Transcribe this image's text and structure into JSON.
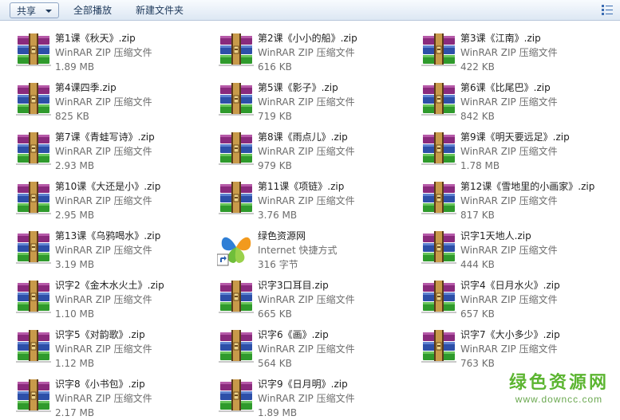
{
  "toolbar": {
    "share_label": "共享",
    "play_all_label": "全部播放",
    "new_folder_label": "新建文件夹",
    "view_icon": "view-options-icon"
  },
  "files": [
    {
      "name": "第1课《秋天》.zip",
      "type": "WinRAR ZIP 压缩文件",
      "size": "1.89 MB",
      "icon": "winrar-archive-icon"
    },
    {
      "name": "第2课《小小的船》.zip",
      "type": "WinRAR ZIP 压缩文件",
      "size": "616 KB",
      "icon": "winrar-archive-icon"
    },
    {
      "name": "第3课《江南》.zip",
      "type": "WinRAR ZIP 压缩文件",
      "size": "422 KB",
      "icon": "winrar-archive-icon"
    },
    {
      "name": "第4课四季.zip",
      "type": "WinRAR ZIP 压缩文件",
      "size": "825 KB",
      "icon": "winrar-archive-icon"
    },
    {
      "name": "第5课《影子》.zip",
      "type": "WinRAR ZIP 压缩文件",
      "size": "719 KB",
      "icon": "winrar-archive-icon"
    },
    {
      "name": "第6课《比尾巴》.zip",
      "type": "WinRAR ZIP 压缩文件",
      "size": "842 KB",
      "icon": "winrar-archive-icon"
    },
    {
      "name": "第7课《青蛙写诗》.zip",
      "type": "WinRAR ZIP 压缩文件",
      "size": "2.93 MB",
      "icon": "winrar-archive-icon"
    },
    {
      "name": "第8课《雨点儿》.zip",
      "type": "WinRAR ZIP 压缩文件",
      "size": "979 KB",
      "icon": "winrar-archive-icon"
    },
    {
      "name": "第9课《明天要远足》.zip",
      "type": "WinRAR ZIP 压缩文件",
      "size": "1.78 MB",
      "icon": "winrar-archive-icon"
    },
    {
      "name": "第10课《大还是小》.zip",
      "type": "WinRAR ZIP 压缩文件",
      "size": "2.95 MB",
      "icon": "winrar-archive-icon"
    },
    {
      "name": "第11课《项链》.zip",
      "type": "WinRAR ZIP 压缩文件",
      "size": "3.76 MB",
      "icon": "winrar-archive-icon"
    },
    {
      "name": "第12课《雪地里的小画家》.zip",
      "type": "WinRAR ZIP 压缩文件",
      "size": "817 KB",
      "icon": "winrar-archive-icon"
    },
    {
      "name": "第13课《乌鸦喝水》.zip",
      "type": "WinRAR ZIP 压缩文件",
      "size": "3.19 MB",
      "icon": "winrar-archive-icon"
    },
    {
      "name": "绿色资源网",
      "type": "Internet 快捷方式",
      "size": "316 字节",
      "icon": "internet-shortcut-icon"
    },
    {
      "name": "识字1天地人.zip",
      "type": "WinRAR ZIP 压缩文件",
      "size": "444 KB",
      "icon": "winrar-archive-icon"
    },
    {
      "name": "识字2《金木水火土》.zip",
      "type": "WinRAR ZIP 压缩文件",
      "size": "1.10 MB",
      "icon": "winrar-archive-icon"
    },
    {
      "name": "识字3口耳目.zip",
      "type": "WinRAR ZIP 压缩文件",
      "size": "665 KB",
      "icon": "winrar-archive-icon"
    },
    {
      "name": "识字4《日月水火》.zip",
      "type": "WinRAR ZIP 压缩文件",
      "size": "657 KB",
      "icon": "winrar-archive-icon"
    },
    {
      "name": "识字5《对韵歌》.zip",
      "type": "WinRAR ZIP 压缩文件",
      "size": "1.12 MB",
      "icon": "winrar-archive-icon"
    },
    {
      "name": "识字6《画》.zip",
      "type": "WinRAR ZIP 压缩文件",
      "size": "564 KB",
      "icon": "winrar-archive-icon"
    },
    {
      "name": "识字7《大小多少》.zip",
      "type": "WinRAR ZIP 压缩文件",
      "size": "763 KB",
      "icon": "winrar-archive-icon"
    },
    {
      "name": "识字8《小书包》.zip",
      "type": "WinRAR ZIP 压缩文件",
      "size": "2.17 MB",
      "icon": "winrar-archive-icon"
    },
    {
      "name": "识字9《日月明》.zip",
      "type": "WinRAR ZIP 压缩文件",
      "size": "1.89 MB",
      "icon": "winrar-archive-icon"
    }
  ],
  "watermark": {
    "title": "绿色资源网",
    "url": "www.downcc.com"
  },
  "colors": {
    "accent_green": "#5cb531",
    "secondary_text": "#6d6d6d",
    "toolbar_text": "#1e395b"
  }
}
